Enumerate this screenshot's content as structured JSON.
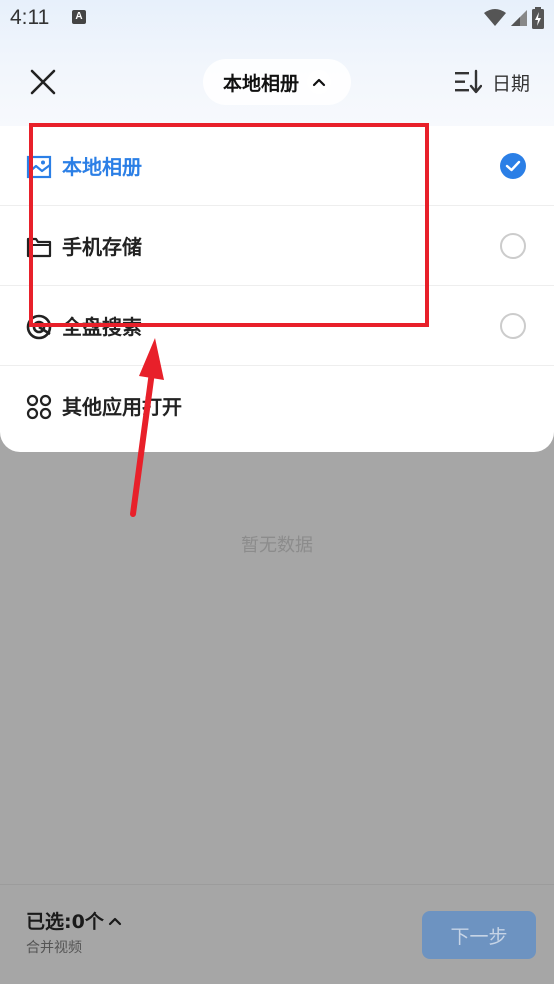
{
  "status_bar": {
    "time": "4:11",
    "notification_glyph": "A"
  },
  "header": {
    "close_icon": "close-icon",
    "album_selector_label": "本地相册",
    "sort_label": "日期"
  },
  "dropdown": {
    "items": [
      {
        "label": "本地相册",
        "icon": "image-icon",
        "selected": true
      },
      {
        "label": "手机存储",
        "icon": "folder-icon",
        "selected": false
      },
      {
        "label": "全盘搜索",
        "icon": "target-search-icon",
        "selected": false
      },
      {
        "label": "其他应用打开",
        "icon": "apps-grid-icon",
        "selected": false
      }
    ]
  },
  "main": {
    "empty_text": "暂无数据"
  },
  "bottom_bar": {
    "selected_count_label": "已选:0个",
    "merge_label": "合并视频",
    "next_label": "下一步"
  },
  "colors": {
    "accent": "#2b7fe6",
    "annotation": "#e8202a",
    "overlay": "#a6a6a6"
  }
}
